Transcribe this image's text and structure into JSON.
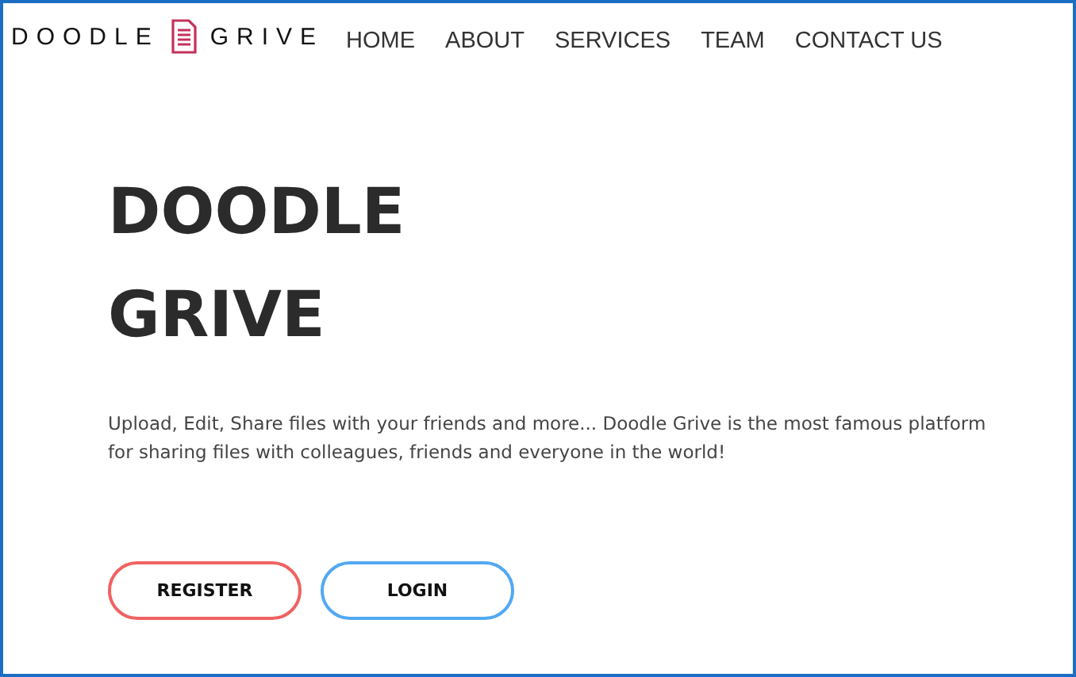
{
  "logo": {
    "left": "DOODLE",
    "right": "GRIVE"
  },
  "nav": [
    "HOME",
    "ABOUT",
    "SERVICES",
    "TEAM",
    "CONTACT US"
  ],
  "hero": {
    "title_lines": [
      "DOODLE",
      "GRIVE"
    ],
    "description": "Upload, Edit, Share files with your friends and more... Doodle Grive is the most famous platform for sharing files with colleagues, friends and everyone in the world!"
  },
  "buttons": [
    {
      "label": "REGISTER",
      "kind": "register"
    },
    {
      "label": "LOGIN",
      "kind": "login"
    }
  ]
}
